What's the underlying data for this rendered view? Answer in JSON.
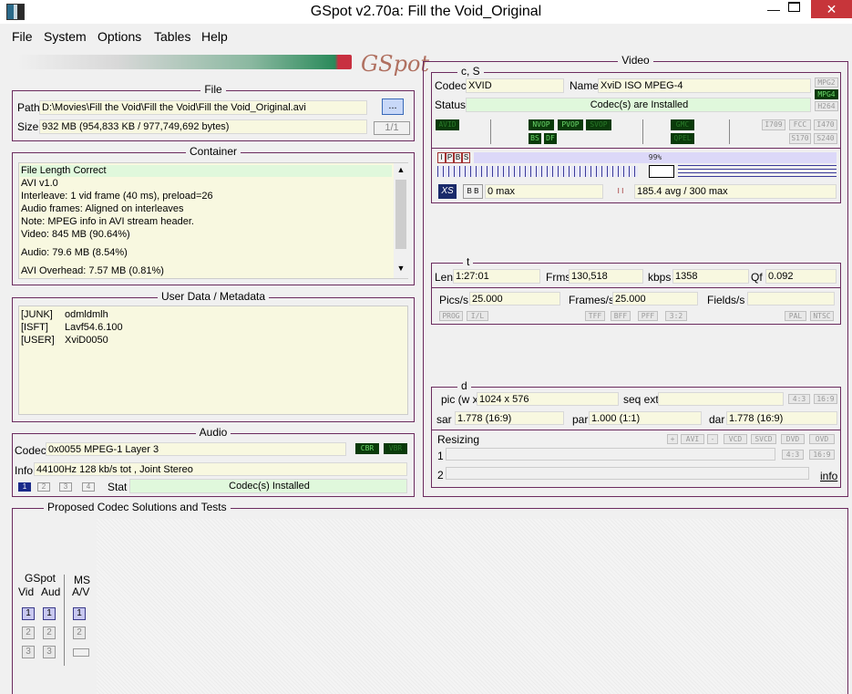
{
  "window": {
    "title": "GSpot v2.70a: Fill the Void_Original"
  },
  "menu": [
    "File",
    "System",
    "Options",
    "Tables",
    "Help"
  ],
  "logo": "GSpot",
  "file": {
    "legend": "File",
    "path_label": "Path",
    "path": "D:\\Movies\\Fill the Void\\Fill the Void\\Fill the Void_Original.avi",
    "browse": "...",
    "size_label": "Size",
    "size": "932 MB (954,833 KB / 977,749,692 bytes)",
    "page": "1/1"
  },
  "container": {
    "legend": "Container",
    "lines": [
      "File Length Correct",
      "AVI v1.0",
      "Interleave: 1 vid frame (40 ms), preload=26",
      "Audio frames: Aligned on interleaves",
      "Note: MPEG info in AVI stream header.",
      "Video: 845 MB (90.64%)",
      "Audio: 79.6 MB (8.54%)",
      "AVI Overhead: 7.57 MB (0.81%)"
    ]
  },
  "userdata": {
    "legend": "User Data / Metadata",
    "rows": [
      {
        "k": "[JUNK]",
        "v": "odmldmlh"
      },
      {
        "k": "[ISFT]",
        "v": "Lavf54.6.100"
      },
      {
        "k": "[USER]",
        "v": "XviD0050"
      }
    ]
  },
  "audio": {
    "legend": "Audio",
    "codec_label": "Codec",
    "codec": "0x0055 MPEG-1 Layer 3",
    "cbr": "CBR",
    "vbr": "VBR",
    "info_label": "Info",
    "info": "44100Hz  128 kb/s tot , Joint Stereo",
    "tabs": [
      "1",
      "2",
      "3",
      "4"
    ],
    "stat_label": "Stat",
    "stat": "Codec(s) Installed"
  },
  "video": {
    "legend": "Video",
    "cs_legend": "c, S",
    "codec_label": "Codec",
    "codec": "XVID",
    "name_label": "Name",
    "name": "XviD ISO MPEG-4",
    "status_label": "Status",
    "status": "Codec(s) are Installed",
    "right_tags": [
      "MPG2",
      "MPG4",
      "H264"
    ],
    "flags": {
      "avid": "AVID",
      "nvop": "NVOP",
      "pvop": "PVOP",
      "svop": "SVOP",
      "qpel": "QPEL",
      "gmc": "GMC",
      "bs": "BS",
      "df": "DF",
      "t1": "I709",
      "fcc": "FCC",
      "t2": "I470",
      "s170": "S170",
      "s240": "S240"
    },
    "ipbs": [
      "I",
      "P",
      "B",
      "S"
    ],
    "pct": "99%",
    "bb": "B B",
    "bmax": "0 max",
    "ii": "I I",
    "imax": "185.4 avg / 300 max",
    "t_legend": "t",
    "len_label": "Len",
    "len": "1:27:01",
    "frms_label": "Frms",
    "frms": "130,518",
    "kbps_label": "kbps",
    "kbps": "1358",
    "qf_label": "Qf",
    "qf": "0.092",
    "pics_label": "Pics/s",
    "pics": "25.000",
    "frames_label": "Frames/s",
    "frames": "25.000",
    "fields_label": "Fields/s",
    "fields": "",
    "scan": [
      "PROG",
      "I/L",
      "TFF",
      "BFF",
      "PFF",
      "3:2",
      "PAL",
      "NTSC"
    ],
    "d_legend": "d",
    "pic_label": "pic (w x",
    "pic": "1024 x 576",
    "seq_label": "seq ext",
    "seq": "",
    "ar1": "4:3",
    "ar2": "16:9",
    "sar_label": "sar",
    "sar": "1.778 (16:9)",
    "par_label": "par",
    "par": "1.000 (1:1)",
    "dar_label": "dar",
    "dar": "1.778 (16:9)",
    "resizing_label": "Resizing",
    "resize_btns": [
      "+",
      "AVI",
      "-",
      "VCD",
      "SVCD",
      "DVD",
      "OVD"
    ],
    "r1": "1",
    "r2": "2",
    "r_ar1": "4:3",
    "r_ar2": "16:9",
    "info": "info"
  },
  "proposed": {
    "legend": "Proposed Codec Solutions and Tests",
    "gspot": "GSpot",
    "ms": "MS",
    "vid": "Vid",
    "aud": "Aud",
    "av": "A/V"
  }
}
